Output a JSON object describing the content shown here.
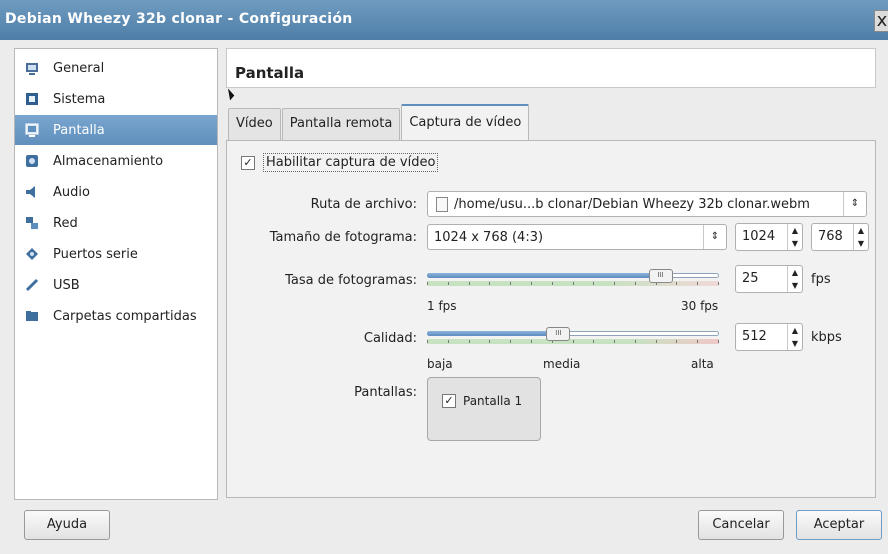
{
  "window": {
    "title": "Debian Wheezy 32b clonar - Configuración",
    "close_glyph": "x"
  },
  "sidebar": {
    "items": [
      {
        "label": "General",
        "icon": "general-icon",
        "selected": false
      },
      {
        "label": "Sistema",
        "icon": "system-chip-icon",
        "selected": false
      },
      {
        "label": "Pantalla",
        "icon": "display-monitor-icon",
        "selected": true
      },
      {
        "label": "Almacenamiento",
        "icon": "storage-disk-icon",
        "selected": false
      },
      {
        "label": "Audio",
        "icon": "speaker-icon",
        "selected": false
      },
      {
        "label": "Red",
        "icon": "network-icon",
        "selected": false
      },
      {
        "label": "Puertos serie",
        "icon": "serial-port-icon",
        "selected": false
      },
      {
        "label": "USB",
        "icon": "usb-icon",
        "selected": false
      },
      {
        "label": "Carpetas compartidas",
        "icon": "shared-folder-icon",
        "selected": false
      }
    ]
  },
  "page": {
    "title": "Pantalla"
  },
  "tabs": [
    {
      "label": "Vídeo",
      "selected": false
    },
    {
      "label": "Pantalla remota",
      "selected": false
    },
    {
      "label": "Captura de vídeo",
      "selected": true
    }
  ],
  "capture": {
    "enable_label": "Habilitar captura de vídeo",
    "enable_checked": true,
    "enable_check_glyph": "✓",
    "file_path": {
      "label": "Ruta de archivo:",
      "value": "/home/usu...b clonar/Debian Wheezy 32b clonar.webm"
    },
    "frame_size": {
      "label": "Tamaño de fotograma:",
      "value": "1024 x 768 (4:3)",
      "width": "1024",
      "height": "768"
    },
    "frame_rate": {
      "label": "Tasa de fotogramas:",
      "value": "25",
      "unit": "fps",
      "min_label": "1 fps",
      "max_label": "30 fps",
      "fraction": 0.8
    },
    "quality": {
      "label": "Calidad:",
      "value": "512",
      "unit": "kbps",
      "low_label": "baja",
      "mid_label": "media",
      "high_label": "alta",
      "fraction": 0.45
    },
    "screens": {
      "label": "Pantallas:",
      "item_label": "Pantalla 1",
      "checked": true
    }
  },
  "buttons": {
    "help": "Ayuda",
    "cancel": "Cancelar",
    "ok": "Aceptar"
  }
}
